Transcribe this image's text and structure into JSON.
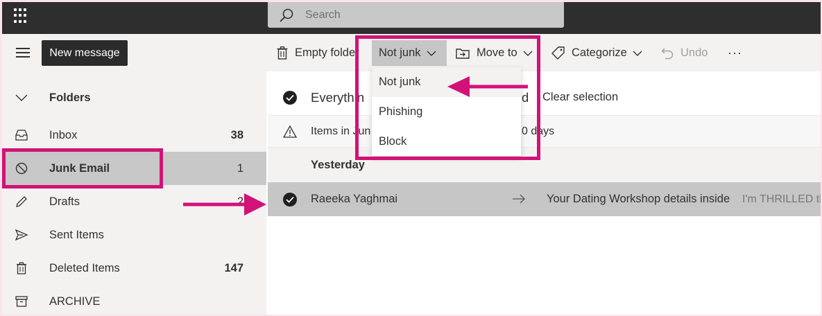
{
  "search": {
    "placeholder": "Search"
  },
  "toolbar": {
    "new_message": "New message",
    "empty_folder": "Empty folder",
    "not_junk": "Not junk",
    "move_to": "Move to",
    "categorize": "Categorize",
    "undo": "Undo",
    "more": "···"
  },
  "sidebar": {
    "folders_label": "Folders",
    "items": [
      {
        "label": "Inbox",
        "count": "38"
      },
      {
        "label": "Junk Email",
        "count": "1"
      },
      {
        "label": "Drafts",
        "count": "2"
      },
      {
        "label": "Sent Items",
        "count": ""
      },
      {
        "label": "Deleted Items",
        "count": "147"
      },
      {
        "label": "ARCHIVE",
        "count": ""
      }
    ]
  },
  "list": {
    "select_all_partial": "Everythin",
    "select_all_tail": "d",
    "clear_selection": "Clear selection",
    "info_partial": "Items in Jun",
    "info_tail": "0 days",
    "group_header": "Yesterday",
    "message": {
      "sender": "Raeeka Yaghmai",
      "subject": "Your Dating Workshop details inside",
      "preview": "I'm THRILLED that"
    }
  },
  "dropdown": {
    "items": [
      "Not junk",
      "Phishing",
      "Block"
    ]
  },
  "colors": {
    "annotation": "#d21278",
    "topbar": "#2e2e2e",
    "selected": "#c8c8c8"
  }
}
